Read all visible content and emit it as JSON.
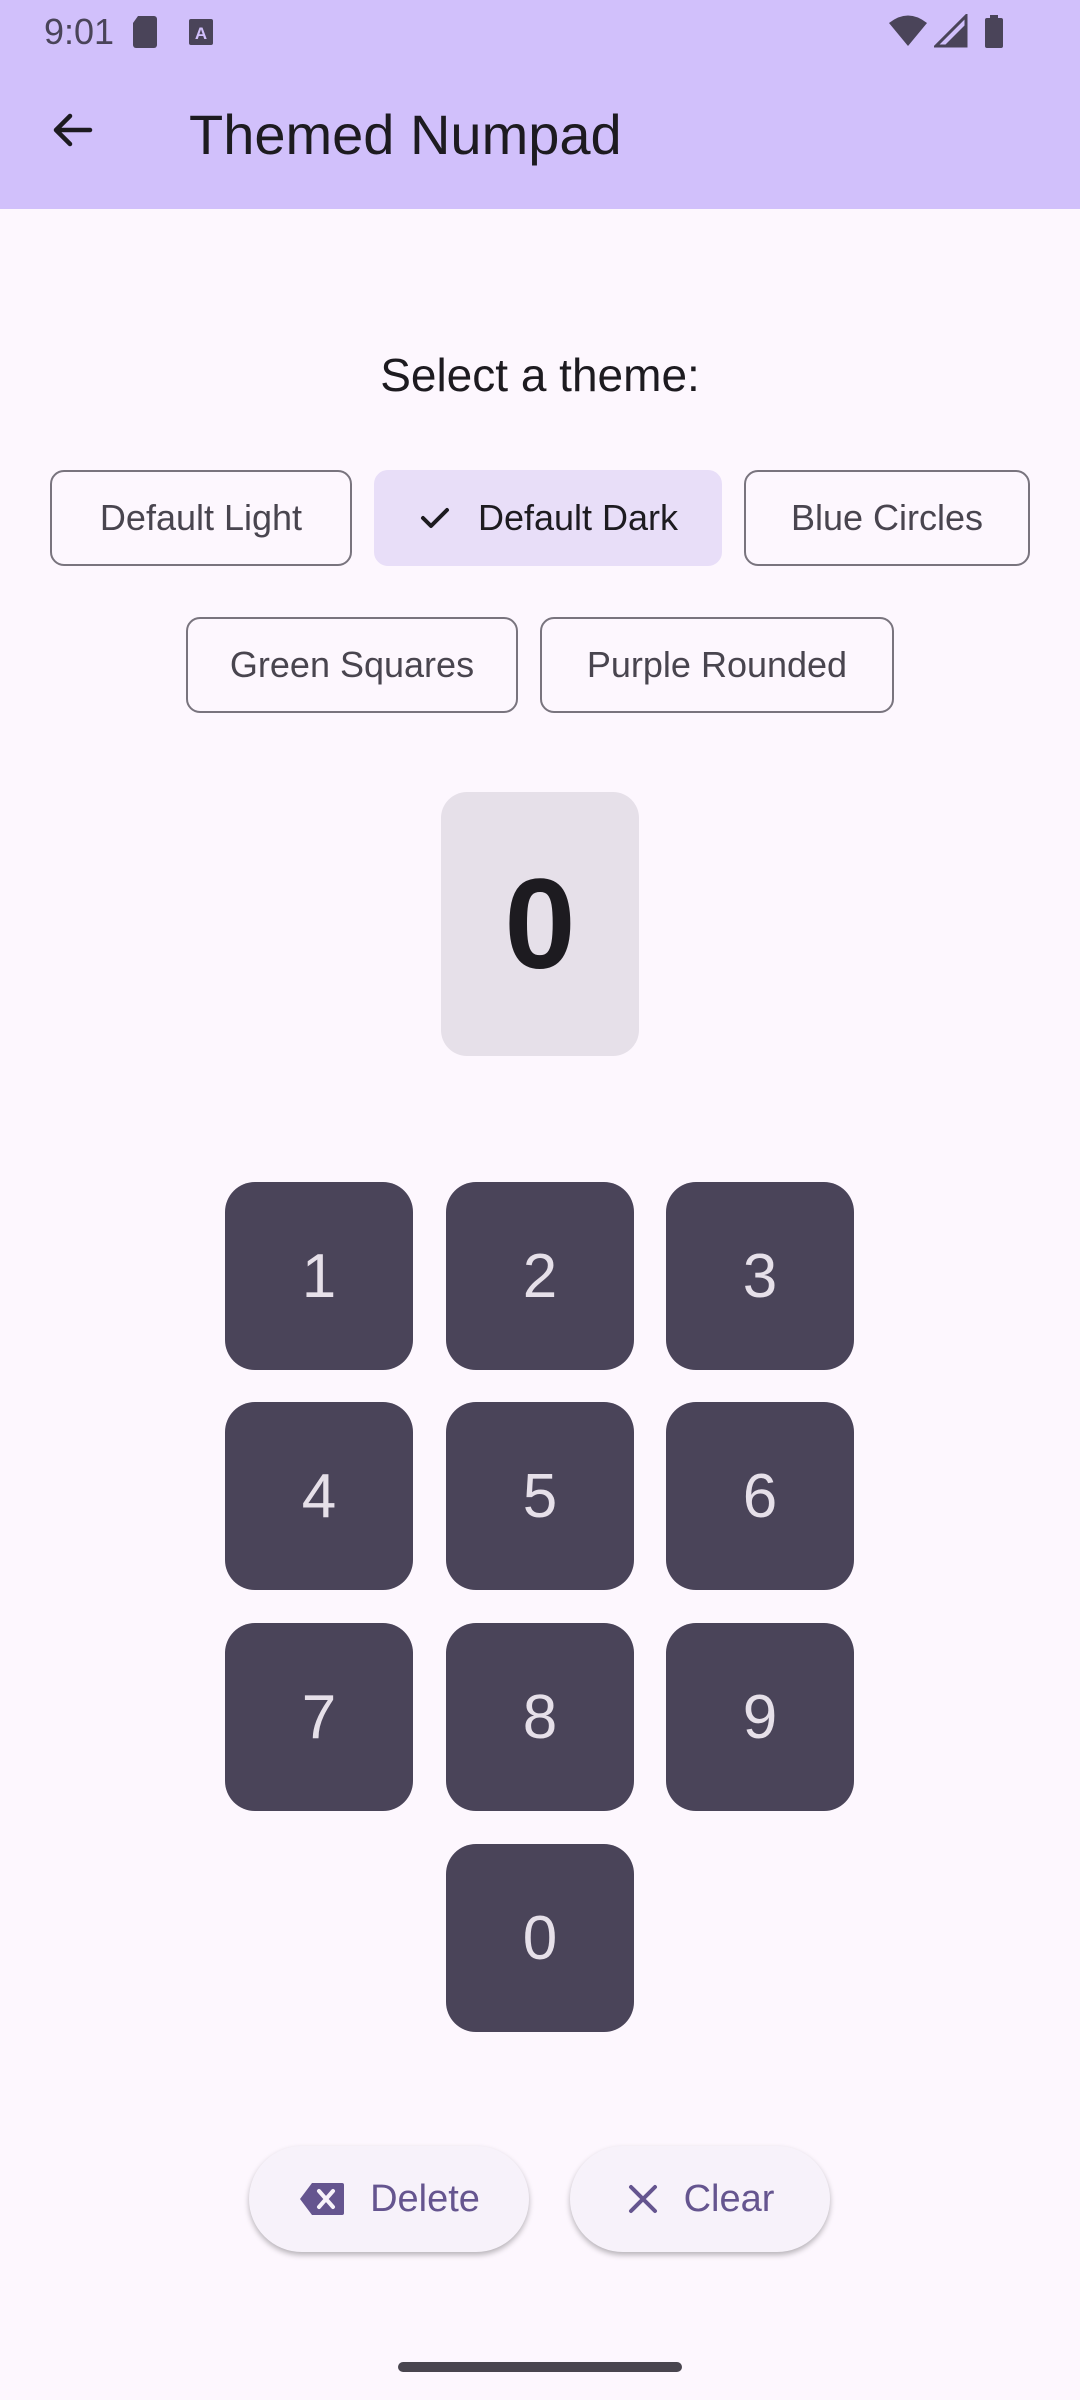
{
  "status_bar": {
    "time": "9:01",
    "icons": [
      "sd-card-icon",
      "keyboard-a-icon",
      "wifi-icon",
      "signal-icon",
      "battery-icon"
    ]
  },
  "app_bar": {
    "title": "Themed Numpad",
    "back_icon": "arrow-back-icon"
  },
  "theme_selector": {
    "label": "Select a theme:",
    "selected": "Default Dark",
    "chips": [
      {
        "label": "Default Light",
        "selected": false
      },
      {
        "label": "Default Dark",
        "selected": true
      },
      {
        "label": "Blue Circles",
        "selected": false
      },
      {
        "label": "Green Squares",
        "selected": false
      },
      {
        "label": "Purple Rounded",
        "selected": false
      }
    ]
  },
  "display": {
    "value": "0"
  },
  "keypad": {
    "keys": [
      "1",
      "2",
      "3",
      "4",
      "5",
      "6",
      "7",
      "8",
      "9",
      "0"
    ]
  },
  "actions": {
    "delete_label": "Delete",
    "clear_label": "Clear"
  },
  "colors": {
    "app_bar": "#d1c0fb",
    "background": "#fdf7fe",
    "key_background": "#4a4459",
    "key_text": "#e6e0e9",
    "selected_chip": "#e8def8",
    "accent": "#65558f"
  }
}
